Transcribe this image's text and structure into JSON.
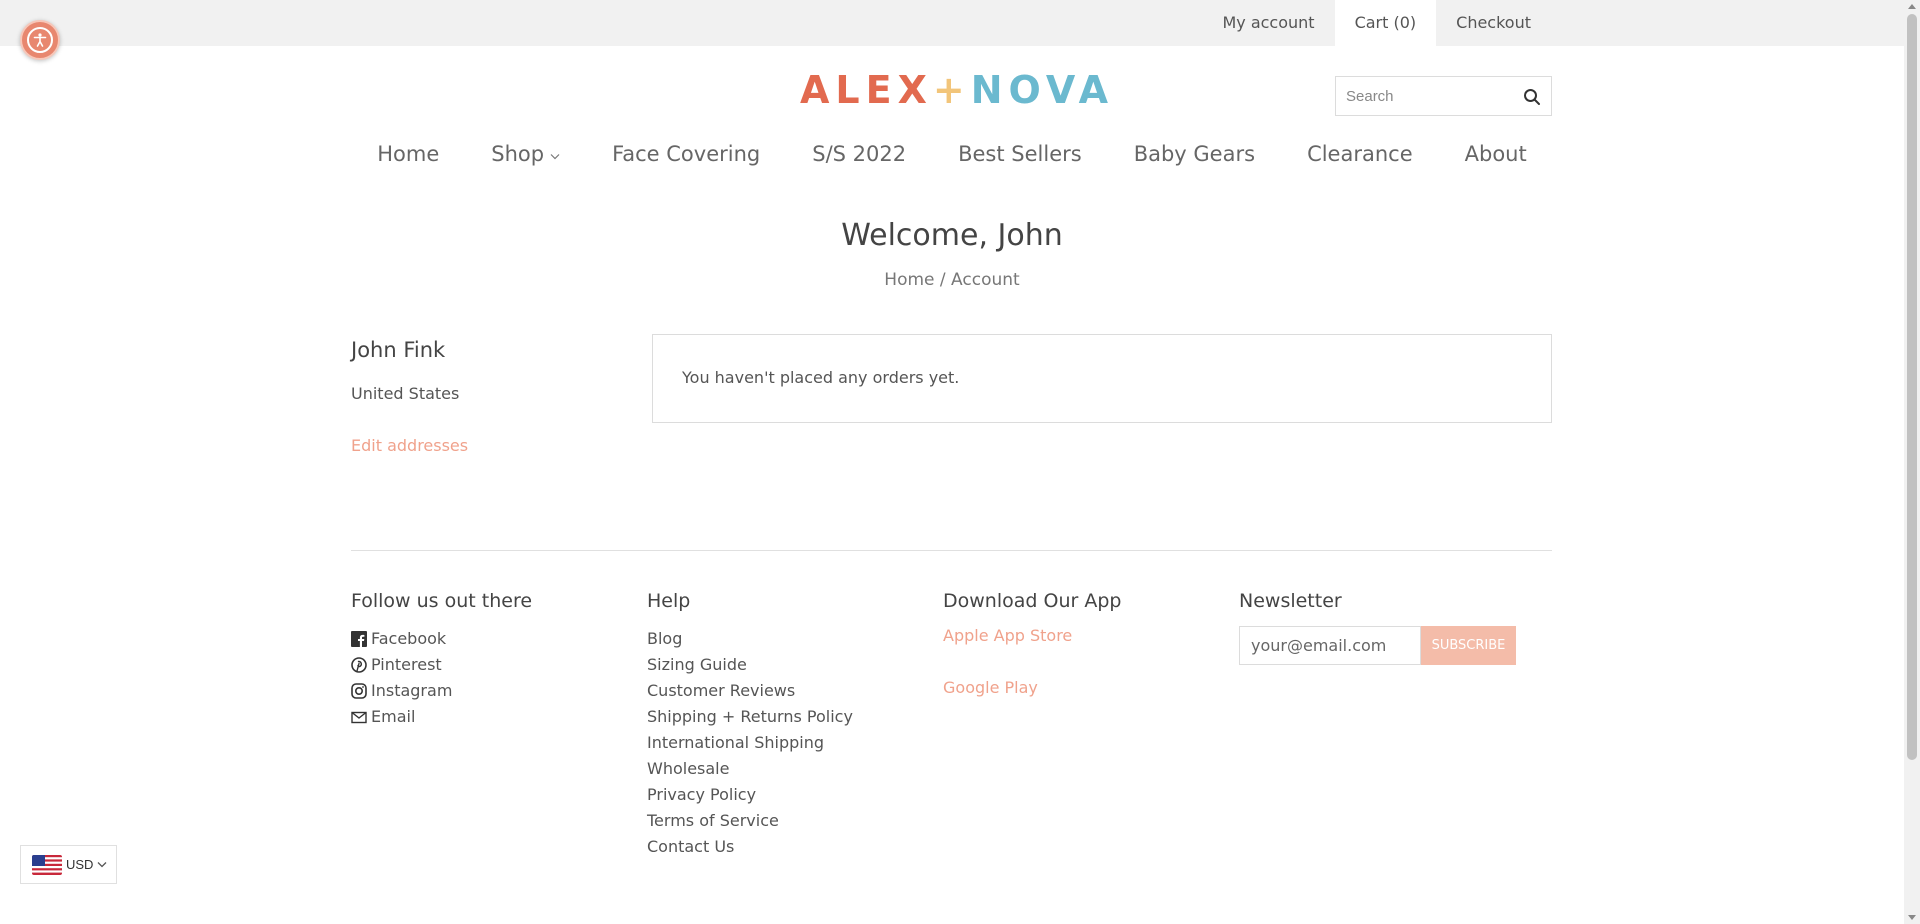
{
  "topbar": {
    "my_account": "My account",
    "cart": "Cart (0)",
    "checkout": "Checkout"
  },
  "logo": {
    "part1": "ALEX",
    "plus": "+",
    "part2": "NOVA"
  },
  "search": {
    "placeholder": "Search",
    "icon": "search-icon"
  },
  "nav": {
    "items": [
      {
        "label": "Home"
      },
      {
        "label": "Shop",
        "has_dropdown": true
      },
      {
        "label": "Face Covering"
      },
      {
        "label": "S/S 2022"
      },
      {
        "label": "Best Sellers"
      },
      {
        "label": "Baby Gears"
      },
      {
        "label": "Clearance"
      },
      {
        "label": "About"
      }
    ]
  },
  "page": {
    "title": "Welcome, John",
    "breadcrumb_home": "Home",
    "breadcrumb_sep": "/",
    "breadcrumb_current": "Account"
  },
  "account": {
    "name": "John Fink",
    "country": "United States",
    "edit_addresses": "Edit addresses",
    "orders_message": "You haven't placed any orders yet."
  },
  "footer": {
    "follow": {
      "heading": "Follow us out there",
      "links": [
        {
          "label": "Facebook",
          "icon": "facebook-icon"
        },
        {
          "label": "Pinterest",
          "icon": "pinterest-icon"
        },
        {
          "label": "Instagram",
          "icon": "instagram-icon"
        },
        {
          "label": "Email",
          "icon": "email-icon"
        }
      ]
    },
    "help": {
      "heading": "Help",
      "links": [
        "Blog",
        "Sizing Guide",
        "Customer Reviews",
        "Shipping + Returns Policy",
        "International Shipping",
        "Wholesale",
        "Privacy Policy",
        "Terms of Service",
        "Contact Us"
      ]
    },
    "app": {
      "heading": "Download Our App",
      "links": [
        "Apple App Store",
        "Google Play"
      ]
    },
    "newsletter": {
      "heading": "Newsletter",
      "placeholder": "your@email.com",
      "button": "SUBSCRIBE"
    }
  },
  "currency": {
    "code": "USD",
    "flag": "us-flag-icon"
  },
  "colors": {
    "accent": "#f0a28c",
    "logo_orange": "#e26a4f",
    "logo_blue": "#6bb9cf",
    "logo_plus": "#f2c57a",
    "subscribe_bg": "#f4bca9"
  }
}
